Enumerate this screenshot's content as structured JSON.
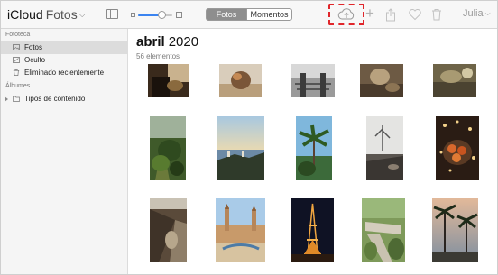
{
  "toolbar": {
    "brand_primary": "iCloud",
    "brand_secondary": "Fotos",
    "segments": [
      "Fotos",
      "Momentos"
    ],
    "selected_segment": "Fotos",
    "user": "Julia",
    "zoom_level": 0.7,
    "icons": [
      "sidebar-toggle-icon",
      "zoom-small-icon",
      "zoom-large-icon",
      "upload-icon",
      "add-icon",
      "share-icon",
      "favorite-icon",
      "trash-icon"
    ],
    "highlight_color": "#e0262b"
  },
  "sidebar": {
    "section_library": "Fototeca",
    "items": [
      {
        "label": "Fotos",
        "icon": "photos-icon",
        "selected": true
      },
      {
        "label": "Oculto",
        "icon": "hidden-icon",
        "selected": false
      },
      {
        "label": "Eliminado recientemente",
        "icon": "trash-icon",
        "selected": false
      }
    ],
    "section_albums": "Álbumes",
    "album_items": [
      {
        "label": "Tipos de contenido",
        "icon": "folder-icon",
        "collapsed": true
      }
    ]
  },
  "main": {
    "month": "abril",
    "year": "2020",
    "count": "56 elementos"
  },
  "colors": {
    "accent": "#3b84f0",
    "selected_row": "#dcdcdc",
    "toolbar_bg": "#f7f7f7"
  }
}
